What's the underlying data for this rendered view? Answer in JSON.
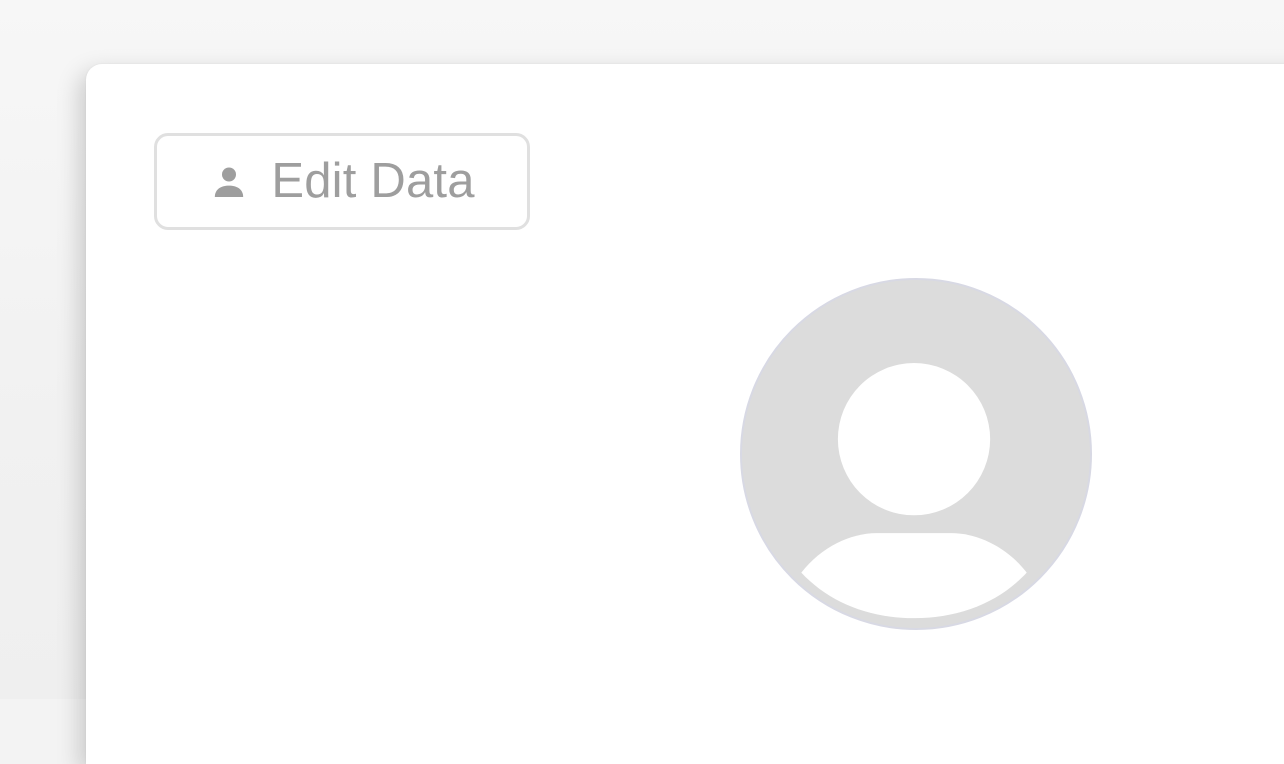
{
  "profile_card": {
    "edit_button": {
      "label": "Edit Data",
      "icon": "person-icon"
    },
    "avatar": {
      "icon": "default-avatar-icon",
      "color": "#dcdcdc"
    }
  },
  "colors": {
    "background": "#f3f3f3",
    "card": "#ffffff",
    "button_border": "#e0e0e0",
    "button_text": "#9e9e9e",
    "avatar_fill": "#dcdcdc",
    "avatar_silhouette": "#ffffff"
  }
}
